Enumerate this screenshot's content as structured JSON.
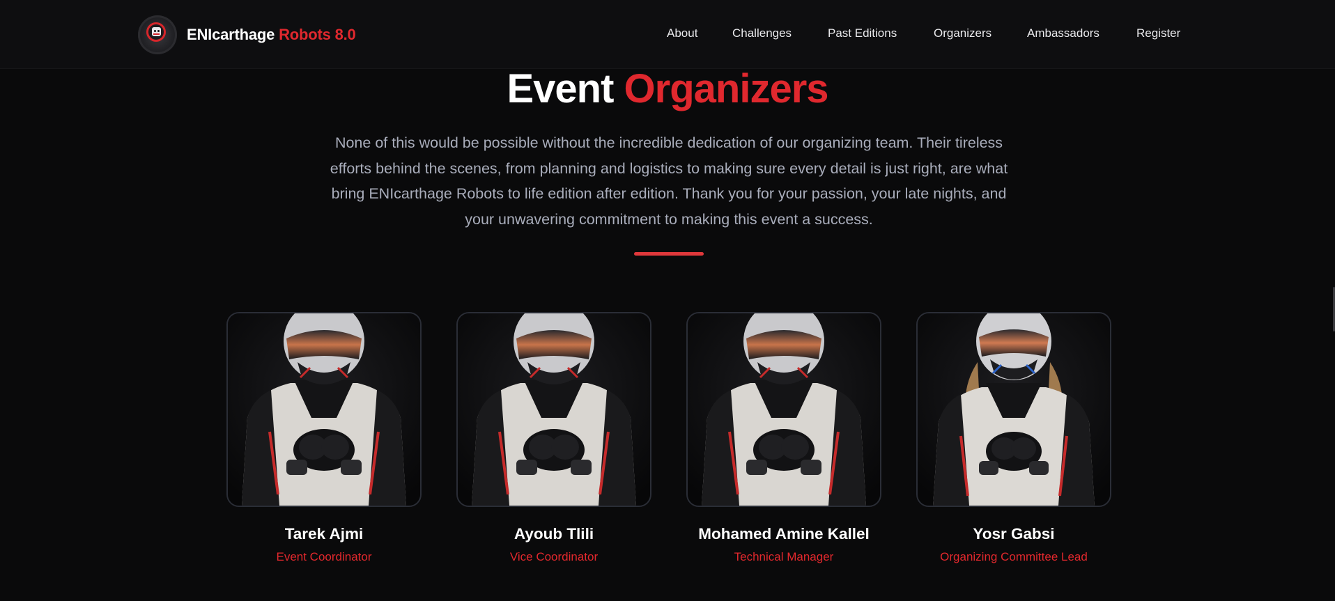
{
  "header": {
    "brand_main": "ENIcarthage",
    "brand_accent": "Robots 8.0",
    "nav": [
      "About",
      "Challenges",
      "Past Editions",
      "Organizers",
      "Ambassadors",
      "Register"
    ]
  },
  "section": {
    "title_main": "Event",
    "title_accent": "Organizers",
    "intro": "None of this would be possible without the incredible dedication of our organizing team. Their tireless efforts behind the scenes, from planning and logistics to making sure every detail is just right, are what bring ENIcarthage Robots to life edition after edition. Thank you for your passion, your late nights, and your unwavering commitment to making this event a success."
  },
  "organizers": [
    {
      "name": "Tarek Ajmi",
      "role": "Event Coordinator",
      "avatar": "racing-driver-helmet-photo"
    },
    {
      "name": "Ayoub Tlili",
      "role": "Vice Coordinator",
      "avatar": "racing-driver-helmet-photo"
    },
    {
      "name": "Mohamed Amine Kallel",
      "role": "Technical Manager",
      "avatar": "racing-driver-helmet-photo"
    },
    {
      "name": "Yosr Gabsi",
      "role": "Organizing Committee Lead",
      "avatar": "racing-driver-helmet-photo-female"
    }
  ],
  "colors": {
    "background": "#0a0a0b",
    "accent": "#e0282e",
    "body_text": "#a9adbb",
    "card_border": "#2a2d36"
  }
}
